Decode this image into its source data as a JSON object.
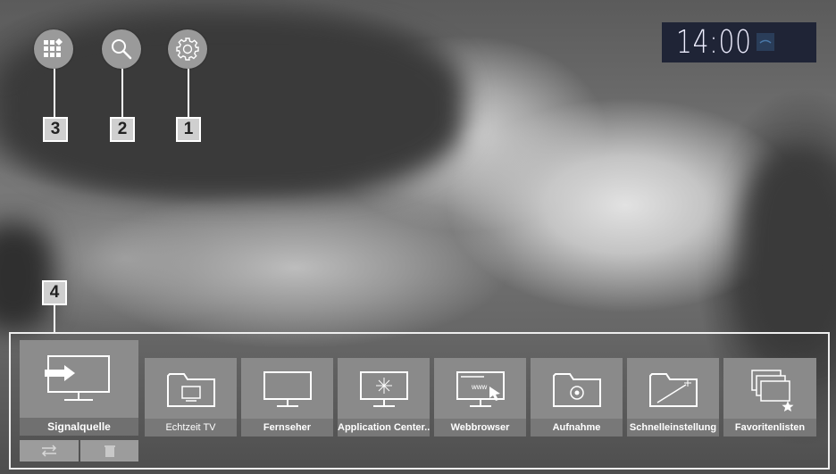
{
  "top_icons": [
    {
      "name": "apps-grid-icon"
    },
    {
      "name": "search-icon"
    },
    {
      "name": "settings-gear-icon"
    }
  ],
  "callouts": {
    "apps": "3",
    "search": "2",
    "settings": "1",
    "bar": "4"
  },
  "clock": {
    "time": "14:00"
  },
  "selected_source": {
    "label": "Signalquelle"
  },
  "apps": [
    {
      "label": "Echtzeit TV",
      "icon": "folder-tv-icon"
    },
    {
      "label": "Fernseher",
      "icon": "monitor-icon"
    },
    {
      "label": "Application Center...",
      "icon": "monitor-sparkle-icon"
    },
    {
      "label": "Webbrowser",
      "icon": "www-monitor-icon"
    },
    {
      "label": "Aufnahme",
      "icon": "folder-record-icon"
    },
    {
      "label": "Schnelleinstellung",
      "icon": "folder-wand-icon"
    },
    {
      "label": "Favoritenlisten",
      "icon": "stacked-windows-star-icon"
    }
  ],
  "sub_buttons": [
    {
      "icon": "swap-arrows-icon"
    },
    {
      "icon": "trash-icon"
    }
  ],
  "colors": {
    "tile": "#8a8a8a",
    "tile_label": "#787878",
    "clock_bg": "#1f2436"
  }
}
